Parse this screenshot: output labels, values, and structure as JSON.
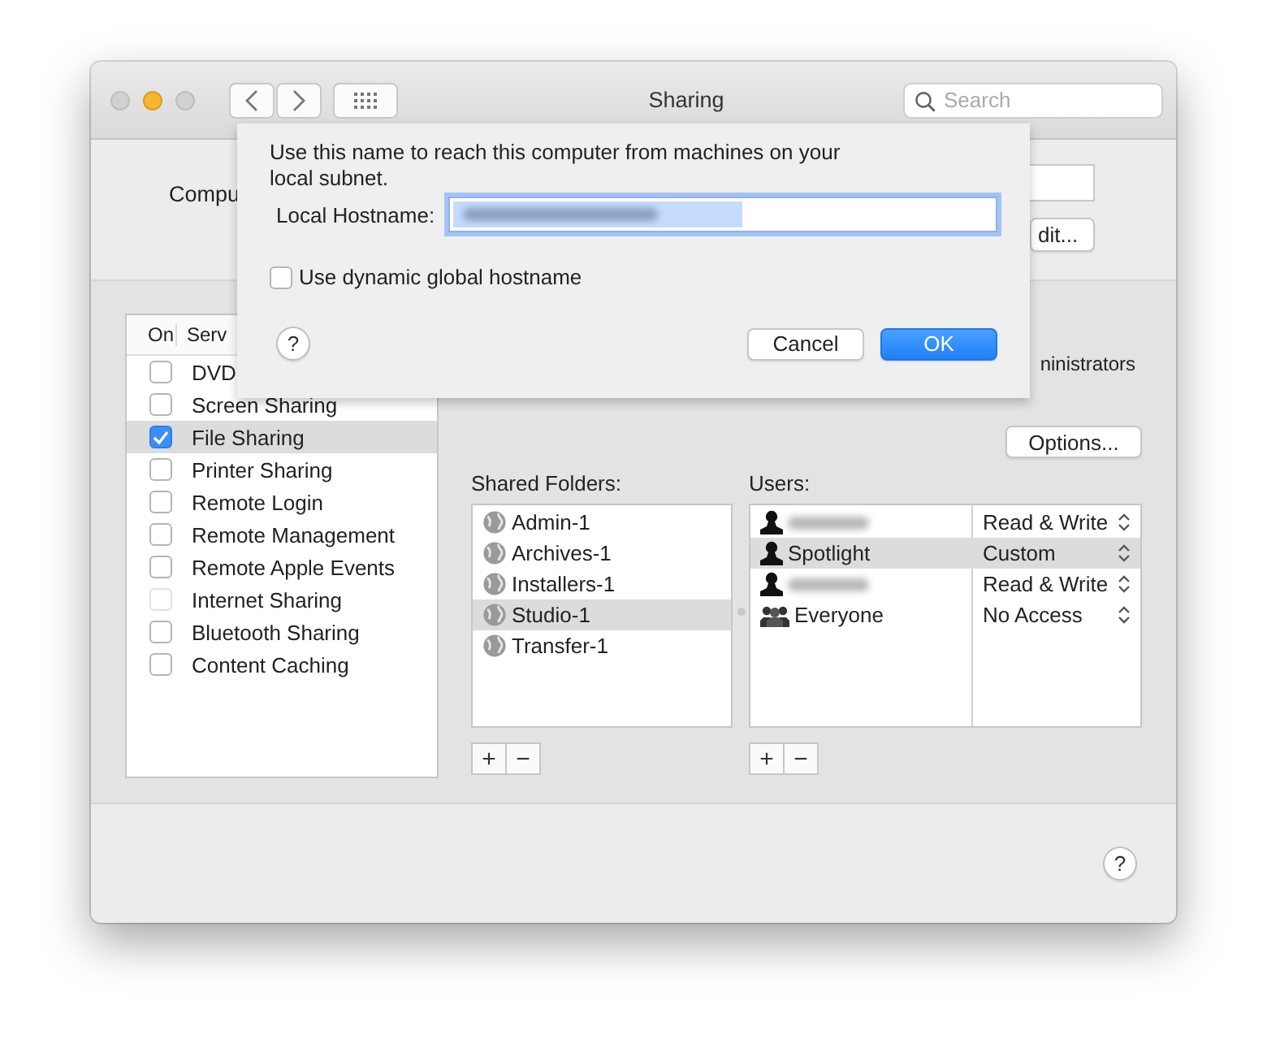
{
  "window": {
    "title": "Sharing",
    "search": {
      "placeholder": "Search"
    }
  },
  "computer_name": {
    "label": "Compu"
  },
  "edit_button": "dit...",
  "services": {
    "columns": [
      "On",
      "Serv"
    ],
    "rows": [
      {
        "name": "DVD",
        "on": false,
        "selected": false,
        "disabled": false
      },
      {
        "name": "Screen Sharing",
        "on": false,
        "selected": false,
        "disabled": false
      },
      {
        "name": "File Sharing",
        "on": true,
        "selected": true,
        "disabled": false
      },
      {
        "name": "Printer Sharing",
        "on": false,
        "selected": false,
        "disabled": false
      },
      {
        "name": "Remote Login",
        "on": false,
        "selected": false,
        "disabled": false
      },
      {
        "name": "Remote Management",
        "on": false,
        "selected": false,
        "disabled": false
      },
      {
        "name": "Remote Apple Events",
        "on": false,
        "selected": false,
        "disabled": false
      },
      {
        "name": "Internet Sharing",
        "on": false,
        "selected": false,
        "disabled": true
      },
      {
        "name": "Bluetooth Sharing",
        "on": false,
        "selected": false,
        "disabled": false
      },
      {
        "name": "Content Caching",
        "on": false,
        "selected": false,
        "disabled": false
      }
    ]
  },
  "access_note": "ninistrators",
  "options_button": "Options...",
  "shared_folders": {
    "label": "Shared Folders:",
    "items": [
      {
        "name": "Admin-1",
        "selected": false
      },
      {
        "name": "Archives-1",
        "selected": false
      },
      {
        "name": "Installers-1",
        "selected": false
      },
      {
        "name": "Studio-1",
        "selected": true
      },
      {
        "name": "Transfer-1",
        "selected": false
      }
    ],
    "add": "+",
    "remove": "−"
  },
  "users": {
    "label": "Users:",
    "items": [
      {
        "kind": "user",
        "redacted": true,
        "permission": "Read & Write",
        "selected": false
      },
      {
        "kind": "user",
        "name": "Spotlight",
        "permission": "Custom",
        "selected": true
      },
      {
        "kind": "user",
        "redacted": true,
        "permission": "Read & Write",
        "selected": false
      },
      {
        "kind": "group",
        "name": "Everyone",
        "permission": "No Access",
        "selected": false
      }
    ],
    "add": "+",
    "remove": "−"
  },
  "help": "?",
  "sheet": {
    "message": "Use this name to reach this computer from machines on your local subnet.",
    "hostname": {
      "label": "Local Hostname:",
      "redacted": true
    },
    "dynamic_hostname": {
      "label": "Use dynamic global hostname",
      "checked": false
    },
    "help": "?",
    "buttons": [
      {
        "label": "Cancel",
        "kind": "secondary"
      },
      {
        "label": "OK",
        "kind": "primary"
      }
    ]
  }
}
